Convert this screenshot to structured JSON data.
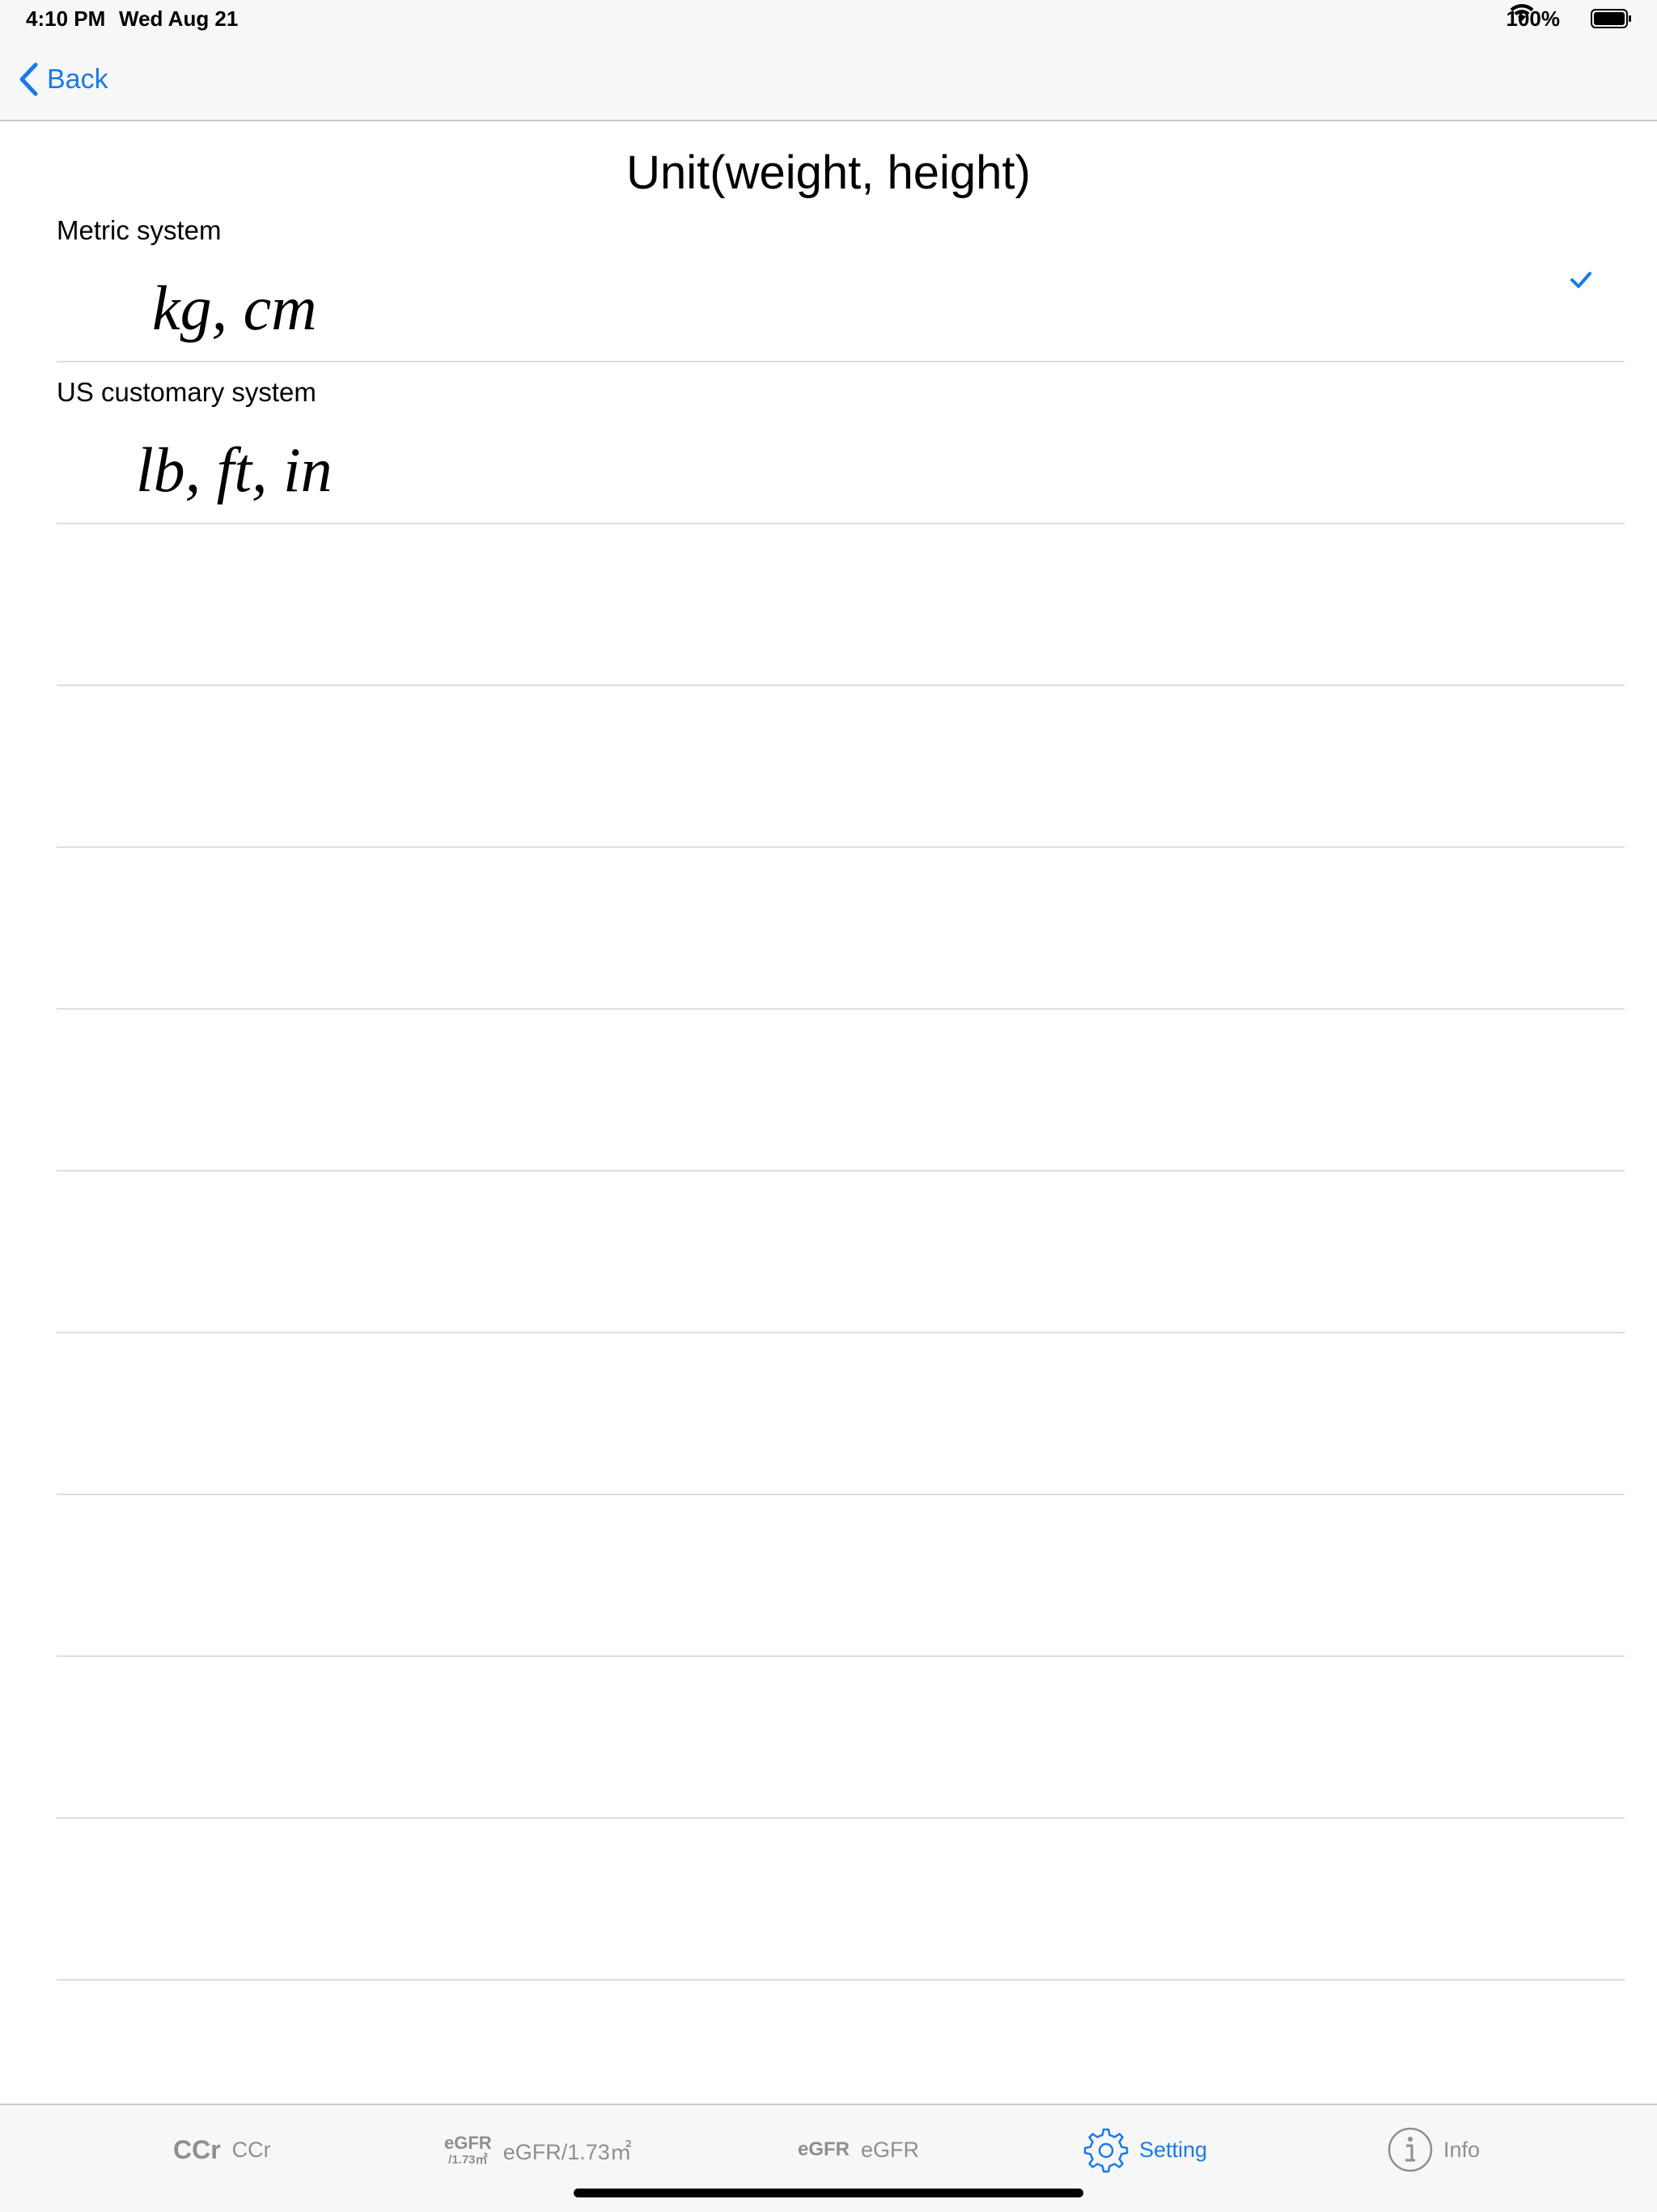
{
  "status_bar": {
    "time": "4:10 PM",
    "date": "Wed Aug 21",
    "battery": "100%"
  },
  "nav": {
    "back_label": "Back"
  },
  "title": "Unit(weight, height)",
  "options": [
    {
      "label": "Metric system",
      "units": "kg, cm",
      "selected": true
    },
    {
      "label": "US customary system",
      "units": "lb, ft, in",
      "selected": false
    }
  ],
  "tabs": [
    {
      "glyph": "CCr",
      "label": "CCr",
      "active": false
    },
    {
      "glyph_top": "eGFR",
      "glyph_bottom": "/1.73㎡",
      "label": "eGFR/1.73㎡",
      "active": false
    },
    {
      "glyph": "eGFR",
      "label": "eGFR",
      "active": false
    },
    {
      "icon": "gear-icon",
      "label": "Setting",
      "active": true
    },
    {
      "icon": "info-icon",
      "label": "Info",
      "active": false
    }
  ],
  "colors": {
    "accent": "#1a7ae8",
    "inactive": "#8e8e93",
    "separator": "#dedede",
    "bar_background": "#f7f7f7"
  }
}
